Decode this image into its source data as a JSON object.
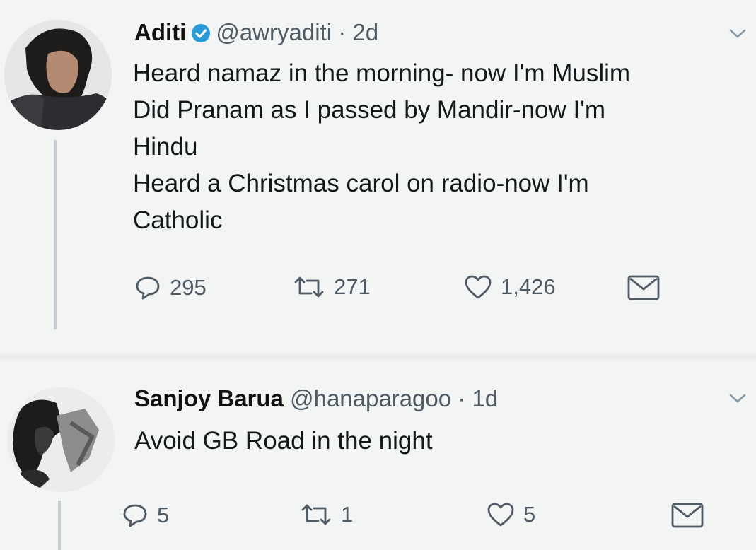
{
  "tweets": [
    {
      "author_name": "Aditi",
      "verified": true,
      "handle": "@awryaditi",
      "separator": "·",
      "time": "2d",
      "lines": [
        "Heard namaz in the morning- now I'm Muslim",
        "Did Pranam as I passed by Mandir-now I'm",
        "Hindu",
        "Heard a Christmas carol on radio-now I'm",
        "Catholic"
      ],
      "replies": "295",
      "retweets": "271",
      "likes": "1,426",
      "icons": [
        "reply-icon",
        "retweet-icon",
        "like-icon",
        "message-icon",
        "chevron-down-icon",
        "verified-badge-icon"
      ]
    },
    {
      "author_name": "Sanjoy Barua",
      "handle": "@hanaparagoo",
      "separator": "·",
      "time": "1d",
      "lines": [
        "Avoid GB Road in the night"
      ],
      "replies": "5",
      "retweets": "1",
      "likes": "5",
      "icons": [
        "reply-icon",
        "retweet-icon",
        "like-icon",
        "message-icon",
        "chevron-down-icon"
      ]
    }
  ],
  "colors": {
    "background": "#f3f4f4",
    "text": "#141619",
    "secondary": "#4e5a64",
    "verified_blue": "#2a9bd8",
    "thread_line": "#c8ced3"
  }
}
